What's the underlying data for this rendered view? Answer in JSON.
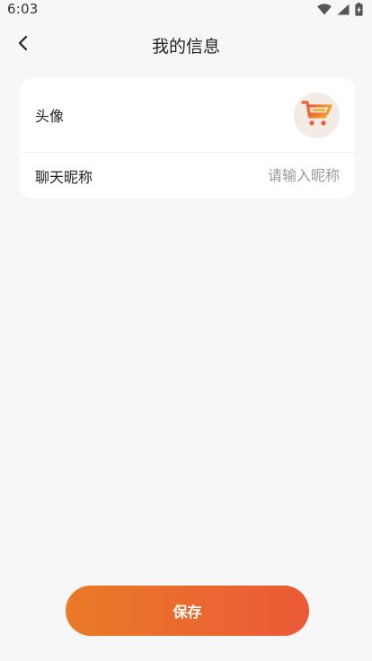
{
  "status_bar": {
    "time": "6:03",
    "icons": [
      "wifi-icon",
      "cellular-signal-icon",
      "battery-charging-icon"
    ]
  },
  "header": {
    "title": "我的信息",
    "back_icon": "chevron-left-icon"
  },
  "profile": {
    "avatar_label": "头像",
    "avatar_icon": "shopping-cart-icon",
    "nickname_label": "聊天昵称",
    "nickname_value": "",
    "nickname_placeholder": "请输入昵称"
  },
  "actions": {
    "save_label": "保存"
  },
  "colors": {
    "background": "#f7f7f7",
    "card": "#ffffff",
    "accent_start": "#ea7a26",
    "accent_end": "#eb5a37",
    "avatar_bg": "#f3ebe4",
    "placeholder": "#9a9a9a"
  }
}
